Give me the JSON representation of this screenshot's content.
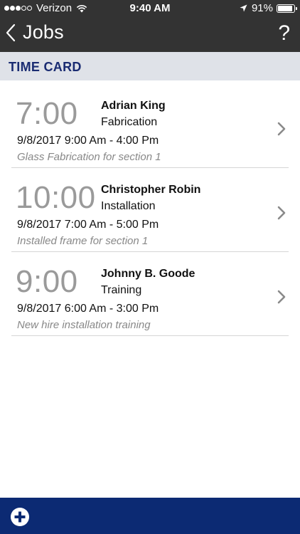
{
  "status_bar": {
    "carrier": "Verizon",
    "time": "9:40 AM",
    "battery": "91%",
    "battery_level": 0.91,
    "signal_dots_filled": 3
  },
  "nav": {
    "back_label": "Jobs",
    "help_label": "?"
  },
  "section": {
    "title": "TIME CARD"
  },
  "entries": [
    {
      "hours": "7:00",
      "name": "Adrian King",
      "job": "Fabrication",
      "range": "9/8/2017 9:00 Am - 4:00 Pm",
      "note": "Glass Fabrication for section 1"
    },
    {
      "hours": "10:00",
      "name": "Christopher Robin",
      "job": "Installation",
      "range": "9/8/2017 7:00 Am - 5:00 Pm",
      "note": "Installed frame for section 1"
    },
    {
      "hours": "9:00",
      "name": "Johnny B. Goode",
      "job": "Training",
      "range": "9/8/2017 6:00 Am - 3:00 Pm",
      "note": "New hire installation training"
    }
  ],
  "colors": {
    "top_bar": "#333333",
    "section_bg": "#dfe2e8",
    "section_text": "#1a2c72",
    "bottom_bar": "#0c2a73"
  },
  "icons": {
    "back": "chevron-left-icon",
    "help": "question-mark-icon",
    "row": "chevron-right-icon",
    "add": "plus-circle-icon"
  }
}
